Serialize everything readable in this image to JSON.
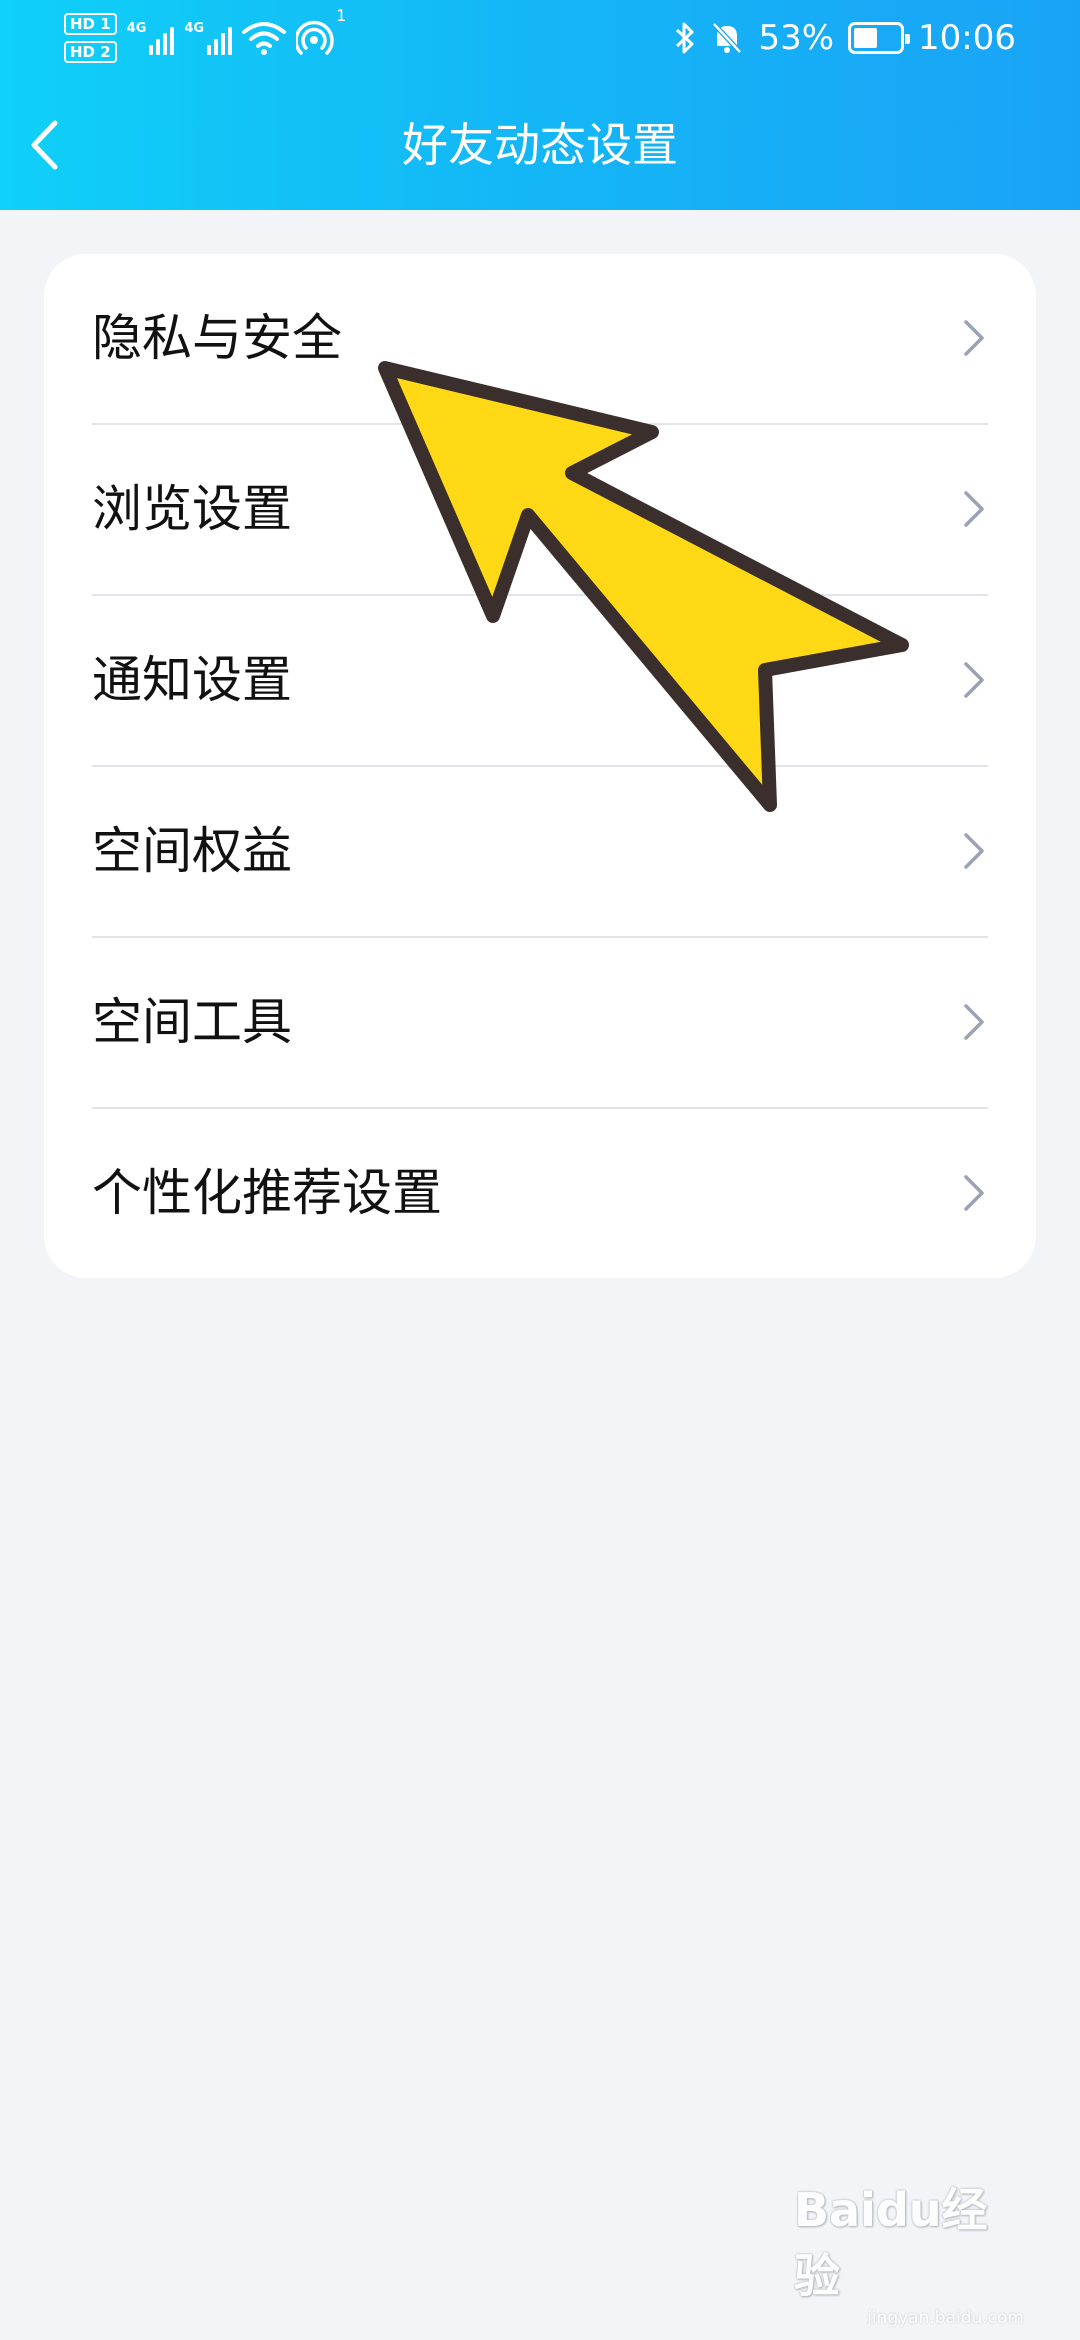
{
  "status_bar": {
    "sim1_label": "HD 1",
    "sim2_label": "HD 2",
    "network1": "4G",
    "network2": "4G",
    "hotspot_count": "1",
    "battery_percent": "53%",
    "battery_level": 0.53,
    "time": "10:06",
    "icons": [
      "bluetooth-icon",
      "bell-muted-icon",
      "wifi-icon",
      "hotspot-icon"
    ]
  },
  "header": {
    "title": "好友动态设置",
    "back_icon": "chevron-left-icon",
    "gradient": [
      "#0fd0f8",
      "#1aa3f6"
    ]
  },
  "settings": {
    "items": [
      {
        "label": "隐私与安全"
      },
      {
        "label": "浏览设置"
      },
      {
        "label": "通知设置"
      },
      {
        "label": "空间权益"
      },
      {
        "label": "空间工具"
      },
      {
        "label": "个性化推荐设置"
      }
    ]
  },
  "overlay": {
    "arrow_color": "#ffd816",
    "arrow_outline": "#3a2f2d"
  },
  "watermark": {
    "text": "Baidu经验",
    "subtext": "jingyan.baidu.com"
  }
}
